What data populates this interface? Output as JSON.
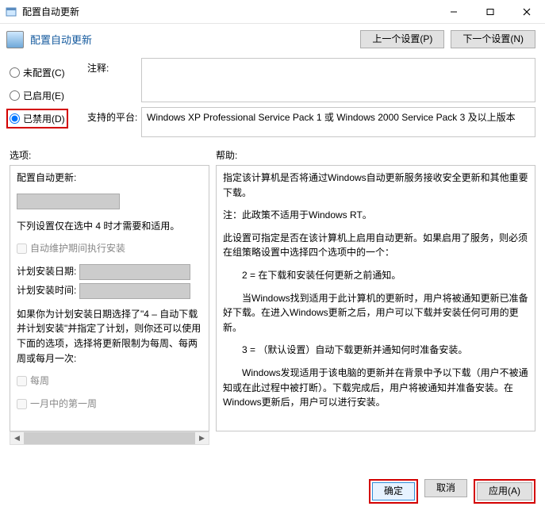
{
  "window": {
    "title": "配置自动更新",
    "minimize": "–",
    "maximize": "□",
    "close": "✕"
  },
  "header": {
    "title": "配置自动更新",
    "prevSetting": "上一个设置(P)",
    "nextSetting": "下一个设置(N)"
  },
  "radio": {
    "notConfigured": "未配置(C)",
    "enabled": "已启用(E)",
    "disabled": "已禁用(D)"
  },
  "info": {
    "commentLabel": "注释:",
    "comment": "",
    "supportedLabel": "支持的平台:",
    "supported": "Windows XP Professional Service Pack 1 或 Windows 2000 Service Pack 3 及以上版本"
  },
  "sections": {
    "optionsLabel": "选项:",
    "helpLabel": "帮助:"
  },
  "options": {
    "title": "配置自动更新:",
    "note": "下列设置仅在选中 4 时才需要和适用。",
    "chkMaint": "自动维护期间执行安装",
    "schedDateLabel": "计划安装日期:",
    "schedTimeLabel": "计划安装时间:",
    "desc": "如果你为计划安装日期选择了\"4 – 自动下载并计划安装\"并指定了计划，则你还可以使用下面的选项，选择将更新限制为每周、每两周或每月一次:",
    "chkWeekly": "每周",
    "chkFirstWeek": "一月中的第一周"
  },
  "help": {
    "p1": "指定该计算机是否将通过Windows自动更新服务接收安全更新和其他重要下载。",
    "p2": "注：此政策不适用于Windows RT。",
    "p3": "此设置可指定是否在该计算机上启用自动更新。如果启用了服务，则必须在组策略设置中选择四个选项中的一个：",
    "p4": "2 = 在下载和安装任何更新之前通知。",
    "p5": "当Windows找到适用于此计算机的更新时，用户将被通知更新已准备好下载。在进入Windows更新之后，用户可以下载并安装任何可用的更新。",
    "p6": "3 = （默认设置）自动下载更新并通知何时准备安装。",
    "p7": "Windows发现适用于该电脑的更新并在背景中予以下载（用户不被通知或在此过程中被打断）。下载完成后，用户将被通知并准备安装。在Windows更新后，用户可以进行安装。"
  },
  "buttons": {
    "ok": "确定",
    "cancel": "取消",
    "apply": "应用(A)"
  }
}
